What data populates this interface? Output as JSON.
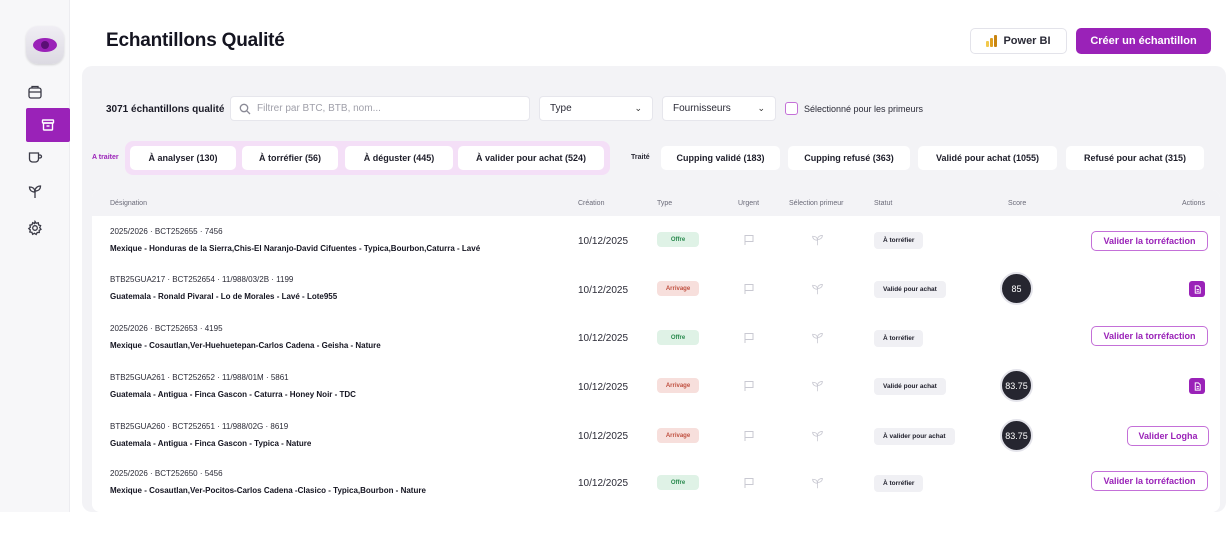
{
  "header": {
    "title": "Echantillons Qualité",
    "powerbi_label": "Power BI",
    "create_label": "Créer un échantillon"
  },
  "colors": {
    "accent": "#9a22b8",
    "offre_bg": "#dff2e6",
    "arrivage_bg": "#f7dfdc",
    "to_process_bg": "#f4dff7"
  },
  "sidebar": {
    "icons": [
      "app-logo-icon",
      "package-icon",
      "archive-icon",
      "cup-icon",
      "sprout-icon",
      "gear-icon"
    ]
  },
  "filters": {
    "count_label": "3071 échantillons qualité",
    "search_placeholder": "Filtrer par BTC, BTB, nom...",
    "type_label": "Type",
    "suppliers_label": "Fournisseurs",
    "primeur_label": "Sélectionné pour les primeurs"
  },
  "status_groups": {
    "to_process": {
      "label": "A traiter",
      "tabs": [
        "À analyser (130)",
        "À torréfier (56)",
        "À déguster (445)",
        "À valider pour achat (524)"
      ]
    },
    "processed": {
      "label": "Traité",
      "tabs": [
        "Cupping validé (183)",
        "Cupping refusé (363)",
        "Validé pour achat (1055)",
        "Refusé pour achat (315)"
      ]
    }
  },
  "table": {
    "columns": [
      "Désignation",
      "Création",
      "Type",
      "Urgent",
      "Sélection primeur",
      "Statut",
      "Score",
      "Actions"
    ],
    "rows": [
      {
        "ref": "2025/2026 · BCT252655 · 7456",
        "name": "Mexique - Honduras de la Sierra,Chis-El Naranjo-David Cifuentes - Typica,Bourbon,Caturra - Lavé",
        "date": "10/12/2025",
        "type": "Offre",
        "status": "À torréfier",
        "score": "",
        "action": "Valider la torréfaction"
      },
      {
        "ref": "BTB25GUA217 · BCT252654 · 11/988/03/2B · 1199",
        "name": "Guatemala - Ronald Pivaral - Lo de Morales - Lavé - Lote955",
        "date": "10/12/2025",
        "type": "Arrivage",
        "status": "Validé pour achat",
        "score": "85",
        "action": ""
      },
      {
        "ref": "2025/2026 · BCT252653 · 4195",
        "name": "Mexique - Cosautlan,Ver-Huehuetepan-Carlos Cadena - Geisha - Nature",
        "date": "10/12/2025",
        "type": "Offre",
        "status": "À torréfier",
        "score": "",
        "action": "Valider la torréfaction"
      },
      {
        "ref": "BTB25GUA261 · BCT252652 · 11/988/01M · 5861",
        "name": "Guatemala - Antigua - Finca Gascon - Caturra - Honey Noir - TDC",
        "date": "10/12/2025",
        "type": "Arrivage",
        "status": "Validé pour achat",
        "score": "83.75",
        "action": ""
      },
      {
        "ref": "BTB25GUA260 · BCT252651 · 11/988/02G · 8619",
        "name": "Guatemala - Antigua - Finca Gascon -  Typica - Nature",
        "date": "10/12/2025",
        "type": "Arrivage",
        "status": "À valider pour achat",
        "score": "83.75",
        "action": "Valider Logha"
      },
      {
        "ref": "2025/2026 · BCT252650 · 5456",
        "name": "Mexique - Cosautlan,Ver-Pocitos-Carlos Cadena -Clasico - Typica,Bourbon - Nature",
        "date": "10/12/2025",
        "type": "Offre",
        "status": "À torréfier",
        "score": "",
        "action": "Valider la torréfaction"
      }
    ]
  }
}
